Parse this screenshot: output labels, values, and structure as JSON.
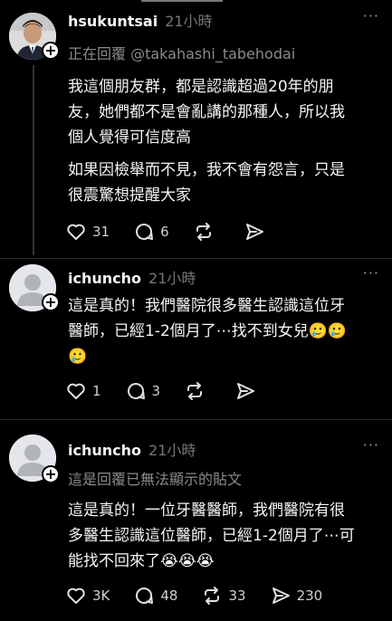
{
  "posts": [
    {
      "username": "hsukuntsai",
      "time": "21小時",
      "reply_to": "正在回覆 @takahashi_tabehodai",
      "paragraphs": [
        "我這個朋友群，都是認識超過20年的朋\n友，她們都不是會亂講的那種人，所以我\n個人覺得可信度高",
        "如果因檢舉而不見，我不會有怨言，只是\n很震驚想提醒大家"
      ],
      "likes": "31",
      "comments": "6",
      "reposts": "",
      "shares": ""
    },
    {
      "username": "ichuncho",
      "time": "21小時",
      "text": "這是真的！我們醫院很多醫生認識這位牙\n醫師，已經1-2個月了⋯找不到女兒🥲🥲\n🥲",
      "likes": "1",
      "comments": "3",
      "reposts": "",
      "shares": ""
    },
    {
      "username": "ichuncho",
      "time": "21小時",
      "reply_to": "這是回覆已無法顯示的貼文",
      "text": "這是真的！一位牙醫醫師，我們醫院有很\n多醫生認識這位醫師，已經1-2個月了⋯可\n能找不回來了😭😭😭",
      "likes": "3K",
      "comments": "48",
      "reposts": "33",
      "shares": "230"
    }
  ],
  "icons": [
    "heart-icon",
    "comment-icon",
    "repost-icon",
    "share-icon",
    "more-icon",
    "follow-plus-icon"
  ],
  "more_label": "···",
  "plus_label": "+"
}
